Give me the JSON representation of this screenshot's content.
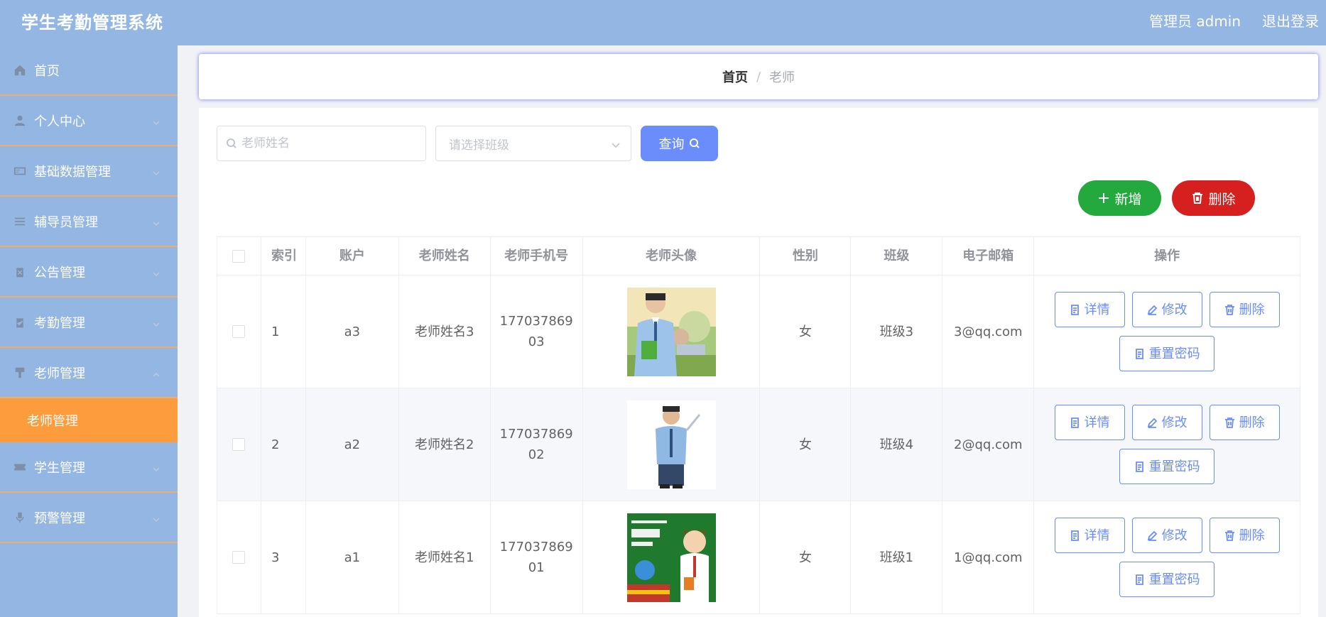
{
  "header": {
    "title": "学生考勤管理系统",
    "user": "管理员 admin",
    "logout": "退出登录"
  },
  "sidebar": {
    "items": [
      {
        "label": "首页",
        "icon": "home-icon"
      },
      {
        "label": "个人中心",
        "icon": "user-icon"
      },
      {
        "label": "基础数据管理",
        "icon": "id-card-icon"
      },
      {
        "label": "辅导员管理",
        "icon": "list-icon"
      },
      {
        "label": "公告管理",
        "icon": "clipboard-x-icon"
      },
      {
        "label": "考勤管理",
        "icon": "clipboard-check-icon"
      },
      {
        "label": "老师管理",
        "icon": "brush-icon"
      },
      {
        "label": "学生管理",
        "icon": "ticket-icon"
      },
      {
        "label": "预警管理",
        "icon": "microphone-icon"
      }
    ],
    "submenu": {
      "label": "老师管理"
    }
  },
  "breadcrumb": {
    "home": "首页",
    "separator": "/",
    "current": "老师"
  },
  "search": {
    "name_placeholder": "老师姓名",
    "class_placeholder": "请选择班级",
    "query_label": "查询"
  },
  "actions": {
    "add_label": "新增",
    "delete_label": "删除"
  },
  "table": {
    "columns": [
      "索引",
      "账户",
      "老师姓名",
      "老师手机号",
      "老师头像",
      "性别",
      "班级",
      "电子邮箱",
      "操作"
    ],
    "rows": [
      {
        "index": "1",
        "account": "a3",
        "name": "老师姓名3",
        "phone": "17703786903",
        "avatar": "teacher-avatar-3",
        "sex": "女",
        "class": "班级3",
        "email": "3@qq.com"
      },
      {
        "index": "2",
        "account": "a2",
        "name": "老师姓名2",
        "phone": "17703786902",
        "avatar": "teacher-avatar-2",
        "sex": "女",
        "class": "班级4",
        "email": "2@qq.com"
      },
      {
        "index": "3",
        "account": "a1",
        "name": "老师姓名1",
        "phone": "17703786901",
        "avatar": "teacher-avatar-1",
        "sex": "女",
        "class": "班级1",
        "email": "1@qq.com"
      }
    ],
    "row_actions": {
      "detail": "详情",
      "edit": "修改",
      "delete": "删除",
      "reset": "重置密码"
    }
  },
  "colors": {
    "header_bg": "#94b6e2",
    "sidebar_bg": "#94b6e2",
    "active_menu": "#fc9c3c",
    "primary": "#6b8dfb",
    "success": "#23a93d",
    "danger": "#d61f1f"
  }
}
